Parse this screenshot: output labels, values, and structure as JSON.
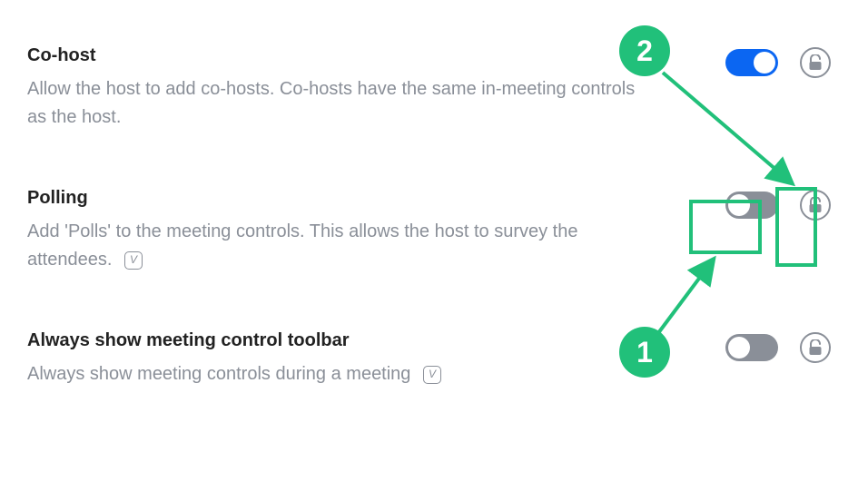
{
  "annotation_color": "#21c07a",
  "markers": {
    "one": "1",
    "two": "2"
  },
  "settings": [
    {
      "key": "cohost",
      "title": "Co-host",
      "description": "Allow the host to add co-hosts. Co-hosts have the same in-meeting controls as the host.",
      "enabled": true,
      "has_v_badge": false
    },
    {
      "key": "polling",
      "title": "Polling",
      "description": "Add 'Polls' to the meeting controls. This allows the host to survey the attendees.",
      "enabled": false,
      "has_v_badge": true
    },
    {
      "key": "toolbar",
      "title": "Always show meeting control toolbar",
      "description": "Always show meeting controls during a meeting",
      "enabled": false,
      "has_v_badge": true
    }
  ]
}
